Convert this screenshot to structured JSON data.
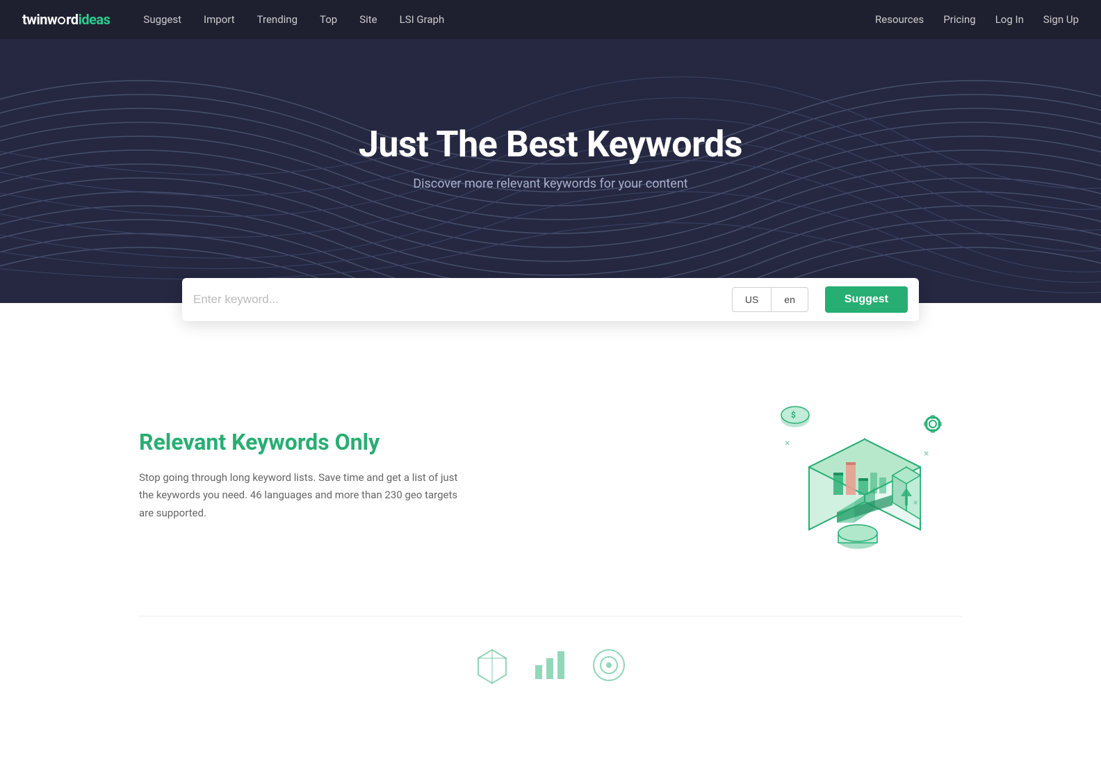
{
  "nav": {
    "logo_twinword": "twinw",
    "logo_dot": "ο",
    "logo_rd": "rd",
    "logo_ideas": "ideas",
    "links_left": [
      {
        "label": "Suggest",
        "href": "#"
      },
      {
        "label": "Import",
        "href": "#"
      },
      {
        "label": "Trending",
        "href": "#"
      },
      {
        "label": "Top",
        "href": "#"
      },
      {
        "label": "Site",
        "href": "#"
      },
      {
        "label": "LSI Graph",
        "href": "#"
      }
    ],
    "links_right": [
      {
        "label": "Resources",
        "href": "#"
      },
      {
        "label": "Pricing",
        "href": "#"
      },
      {
        "label": "Log In",
        "href": "#"
      },
      {
        "label": "Sign Up",
        "href": "#"
      }
    ]
  },
  "hero": {
    "title": "Just The Best Keywords",
    "subtitle": "Discover more relevant keywords for your content"
  },
  "search": {
    "placeholder": "Enter keyword...",
    "country": "US",
    "language": "en",
    "button_label": "Suggest"
  },
  "features": [
    {
      "title": "Relevant Keywords Only",
      "description": "Stop going through long keyword lists. Save time and get a list of just the keywords you need. 46 languages and more than 230 geo targets are supported."
    }
  ],
  "colors": {
    "accent": "#27ae73",
    "nav_bg": "#252840",
    "hero_bg": "#252840"
  }
}
